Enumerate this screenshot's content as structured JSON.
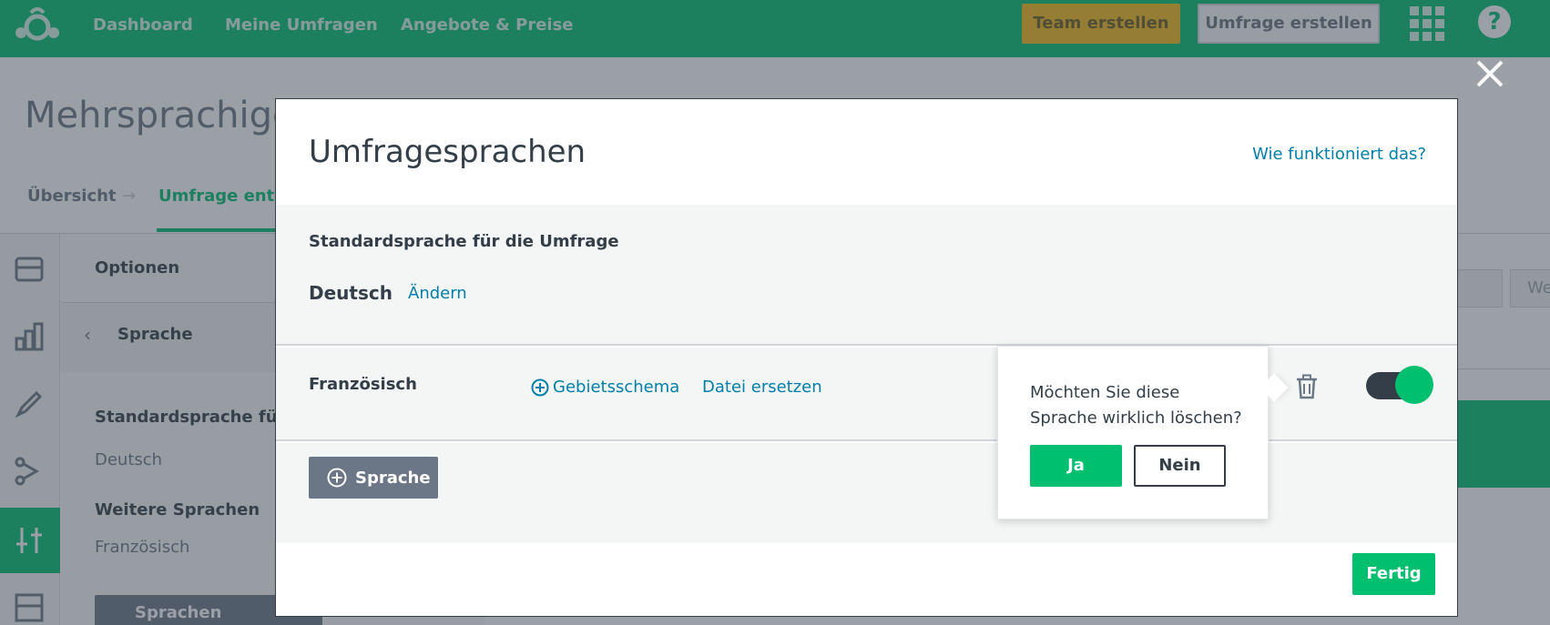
{
  "topnav": {
    "logo_icon": "surveymonkey-logo-icon",
    "links": [
      "Dashboard",
      "Meine Umfragen",
      "Angebote & Preise"
    ],
    "team_button": "Team erstellen",
    "survey_button": "Umfrage erstellen",
    "apps_icon": "apps-grid-icon",
    "help_icon": "help-icon",
    "help_glyph": "?"
  },
  "page": {
    "title": "Mehrsprachige U",
    "breadcrumb": {
      "step1": "Übersicht",
      "arrow": "→",
      "step2": "Umfrage entw"
    }
  },
  "options_panel": {
    "header": "Optionen",
    "back_glyph": "‹",
    "sub_title": "Sprache",
    "default_label": "Standardsprache für d",
    "default_value": "Deutsch",
    "more_label": "Weitere Sprachen",
    "more_value": "Französisch",
    "edit_button": "Sprachen bearbeiten"
  },
  "right_partial": {
    "select_text": "We"
  },
  "modal": {
    "title": "Umfragesprachen",
    "help_link": "Wie funktioniert das?",
    "default_label": "Standardsprache für die Umfrage",
    "default_language": "Deutsch",
    "change_link": "Ändern",
    "languages": [
      {
        "name": "Französisch",
        "locale_link": "Gebietsschema",
        "replace_link": "Datei ersetzen",
        "enabled": true
      }
    ],
    "add_button": "Sprache",
    "done_button": "Fertig"
  },
  "popover": {
    "text": "Möchten Sie diese Sprache wirklich löschen?",
    "yes": "Ja",
    "no": "Nein"
  },
  "colors": {
    "brand_green": "#00bf6f",
    "link_blue": "#007faa",
    "text_dark": "#333e48",
    "overlay": "rgba(55,66,78,0.5)"
  }
}
